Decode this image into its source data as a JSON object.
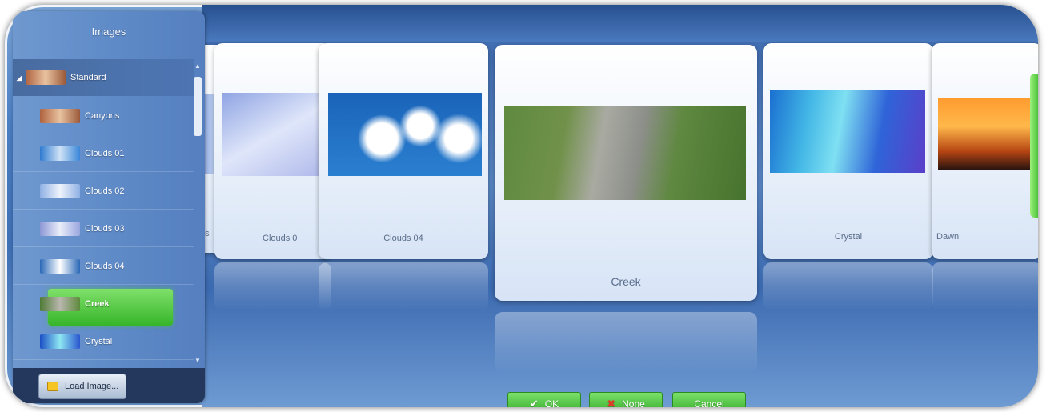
{
  "sidebar": {
    "title": "Images",
    "group": {
      "label": "Standard",
      "expander": "◢"
    },
    "items": [
      {
        "label": "Canyons",
        "thumb": "linear-gradient(90deg,#b0623f,#e8c2a0,#9b5a3a)"
      },
      {
        "label": "Clouds 01",
        "thumb": "linear-gradient(90deg,#2f7ad0,#cfe2f6,#3a86d8)"
      },
      {
        "label": "Clouds 02",
        "thumb": "linear-gradient(90deg,#8fb0e4,#eef3fb,#8fb0e4)"
      },
      {
        "label": "Clouds 03",
        "thumb": "linear-gradient(90deg,#8d98d6,#e9edf9,#9aa6df)"
      },
      {
        "label": "Clouds 04",
        "thumb": "linear-gradient(90deg,#2a68b6,#ffffff,#2a68b6)"
      },
      {
        "label": "Creek",
        "thumb": "linear-gradient(90deg,#4f7b36,#b9b6ae,#5d8a3c)",
        "selected": true
      },
      {
        "label": "Crystal",
        "thumb": "linear-gradient(90deg,#1b4fc4,#8ee7f2,#2a56cf)"
      }
    ],
    "load_button": "Load Image..."
  },
  "carousel": {
    "cards": [
      {
        "label": "ds",
        "style": "linear-gradient(90deg,#7e9fe0,#cbd9f4)"
      },
      {
        "label": "Clouds 0",
        "style": "linear-gradient(150deg,#8fa4e3 0%,#dfe6fa 50%,#aeb8ea 100%)"
      },
      {
        "label": "Clouds 04",
        "style": "radial-gradient(circle at 35% 55%,#ffffff 0,#ffffff 14%,transparent 22%),radial-gradient(circle at 60% 40%,#ffffff 0,#ffffff 12%,transparent 20%),radial-gradient(circle at 85% 55%,#ffffff 0,#ffffff 10%,transparent 18%),linear-gradient(180deg,#1a64b9,#2b7fd0)"
      },
      {
        "label": "Creek",
        "style": "linear-gradient(100deg,#5e8a3f 0%,#71914a 25%,#a9aaa2 40%,#8d8f8a 55%,#5f8840 70%,#46732e 100%)"
      },
      {
        "label": "Crystal",
        "style": "linear-gradient(100deg,#1a6fd0 0%,#43b7e6 25%,#7fe0f2 45%,#2f64d8 70%,#5a3fc9 100%)"
      },
      {
        "label": "Dawn",
        "style": "linear-gradient(180deg,#ff9b2f 0%,#ffb84a 40%,#b44412 75%,#2a1410 100%)"
      }
    ]
  },
  "buttons": {
    "ok": "OK",
    "none": "None",
    "cancel": "Cancel"
  }
}
